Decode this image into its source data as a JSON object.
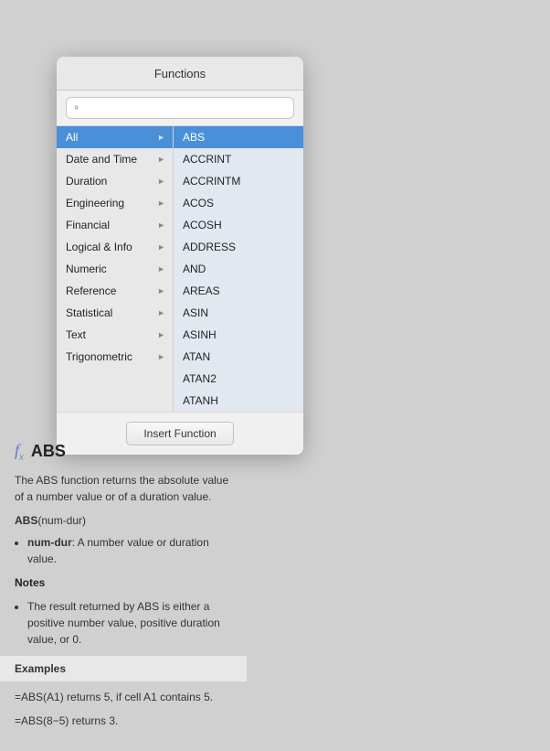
{
  "panel": {
    "title": "Functions",
    "search": {
      "placeholder": "",
      "value": ""
    },
    "insert_button_label": "Insert Function"
  },
  "categories": [
    {
      "id": "all",
      "label": "All",
      "selected": true
    },
    {
      "id": "date-time",
      "label": "Date and Time",
      "selected": false
    },
    {
      "id": "duration",
      "label": "Duration",
      "selected": false
    },
    {
      "id": "engineering",
      "label": "Engineering",
      "selected": false
    },
    {
      "id": "financial",
      "label": "Financial",
      "selected": false
    },
    {
      "id": "logical-info",
      "label": "Logical & Info",
      "selected": false
    },
    {
      "id": "numeric",
      "label": "Numeric",
      "selected": false
    },
    {
      "id": "reference",
      "label": "Reference",
      "selected": false
    },
    {
      "id": "statistical",
      "label": "Statistical",
      "selected": false
    },
    {
      "id": "text",
      "label": "Text",
      "selected": false
    },
    {
      "id": "trigonometric",
      "label": "Trigonometric",
      "selected": false
    }
  ],
  "functions": [
    {
      "label": "ABS",
      "selected": true
    },
    {
      "label": "ACCRINT",
      "selected": false
    },
    {
      "label": "ACCRINTM",
      "selected": false
    },
    {
      "label": "ACOS",
      "selected": false
    },
    {
      "label": "ACOSH",
      "selected": false
    },
    {
      "label": "ADDRESS",
      "selected": false
    },
    {
      "label": "AND",
      "selected": false
    },
    {
      "label": "AREAS",
      "selected": false
    },
    {
      "label": "ASIN",
      "selected": false
    },
    {
      "label": "ASINH",
      "selected": false
    },
    {
      "label": "ATAN",
      "selected": false
    },
    {
      "label": "ATAN2",
      "selected": false
    },
    {
      "label": "ATANH",
      "selected": false
    }
  ],
  "description": {
    "func_name": "ABS",
    "fx_label": "f",
    "fx_sub": "x",
    "summary": "The ABS function returns the absolute value of a number value or of a duration value.",
    "syntax": "ABS",
    "syntax_param": "(num-dur)",
    "param_heading": "num-dur",
    "param_desc": "A number value or duration value.",
    "notes_heading": "Notes",
    "note_text": "The result returned by ABS is either a positive number value, positive duration value, or 0.",
    "examples_heading": "Examples",
    "example1": "=ABS(A1) returns 5, if cell A1 contains 5.",
    "example2": "=ABS(8−5) returns 3."
  }
}
